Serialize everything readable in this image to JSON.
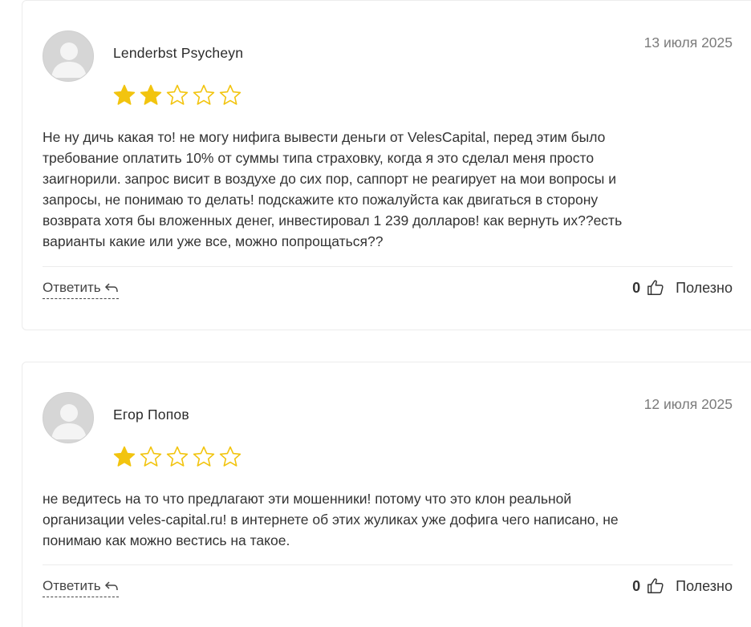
{
  "reviews": [
    {
      "author": "Lenderbst Psycheyn",
      "date": "13 июля 2025",
      "rating": 2,
      "max_rating": 5,
      "text": "Не ну дичь какая то! не могу нифига вывести деньги от VelesCapital, перед этим было\nтребование оплатить 10% от суммы типа страховку, когда я это сделал меня просто\nзаигнорили. запрос висит в воздухе до сих пор, саппорт не реагирует на мои вопросы и\nзапросы, не понимаю то делать! подскажите кто пожалуйста как двигаться в сторону\nвозврата хотя бы вложенных денег, инвестировал 1 239 долларов! как вернуть их??есть\nварианты какие или уже все, можно попрощаться??",
      "reply_label": "Ответить",
      "likes": "0",
      "helpful_label": "Полезно"
    },
    {
      "author": "Егор Попов",
      "date": "12 июля 2025",
      "rating": 1,
      "max_rating": 5,
      "text": "не ведитесь на то что предлагают эти мошенники! потому что это клон реальной\nорганизации veles-capital.ru! в интернете об этих жуликах уже дофига чего написано, не\nпонимаю как можно вестись на такое.",
      "reply_label": "Ответить",
      "likes": "0",
      "helpful_label": "Полезно"
    }
  ],
  "colors": {
    "star_filled": "#f2c40f",
    "star_empty_outline": "#f2c40f",
    "avatar_bg": "#d6d6d6",
    "text": "#333333",
    "date": "#7b7b7b"
  },
  "icons": {
    "avatar": "user-avatar-placeholder-icon",
    "reply": "reply-arrow-icon",
    "helpful": "thumbs-up-icon",
    "star": "star-icon"
  }
}
